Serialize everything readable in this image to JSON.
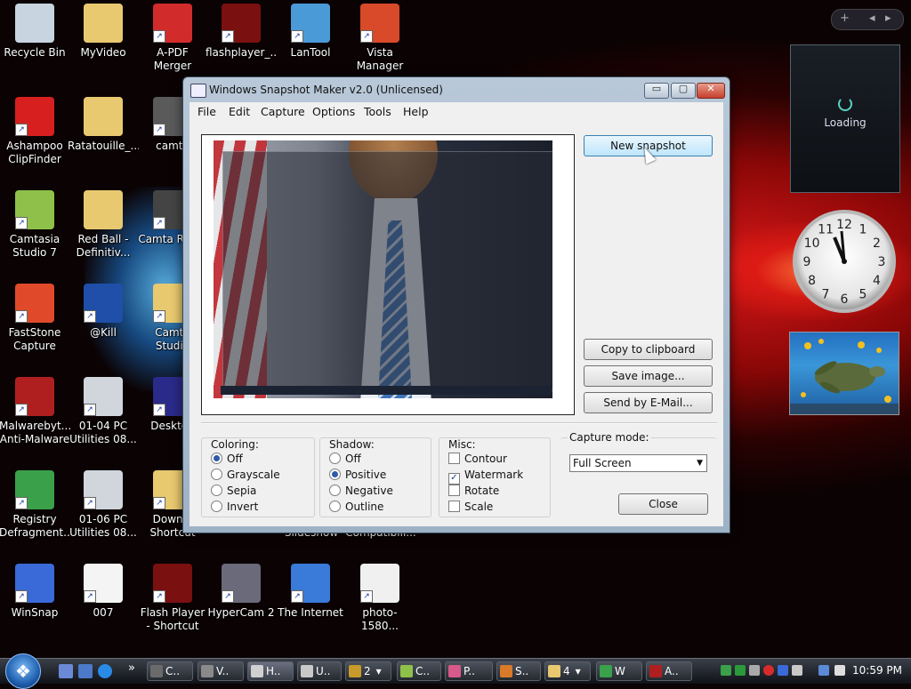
{
  "desktop": {
    "icons": [
      {
        "label": "Recycle Bin",
        "icon": "recycle-bin-icon",
        "color": "#c8d4e0"
      },
      {
        "label": "MyVideo",
        "icon": "folder-icon",
        "color": "#e8c970"
      },
      {
        "label": "A-PDF Merger",
        "icon": "pdf-icon",
        "color": "#d22b2b"
      },
      {
        "label": "flashplayer_...",
        "icon": "flash-icon",
        "color": "#7a1010"
      },
      {
        "label": "LanTool",
        "icon": "lantool-icon",
        "color": "#4a9ad8"
      },
      {
        "label": "Vista Manager",
        "icon": "vista-manager-icon",
        "color": "#d84a2a"
      },
      {
        "label": "Ashampoo ClipFinder",
        "icon": "clipfinder-icon",
        "color": "#d81f1f"
      },
      {
        "label": "Ratatouille_...",
        "icon": "folder-icon",
        "color": "#e8c970"
      },
      {
        "label": "camta",
        "icon": "camtasia-icon",
        "color": "#5a5a5a"
      },
      {
        "label": "Camtasia Studio 7",
        "icon": "camtasia-studio-icon",
        "color": "#8fc14a"
      },
      {
        "label": "Red Ball - Definitiv...",
        "icon": "folder-icon",
        "color": "#e8c970"
      },
      {
        "label": "Camta Recor",
        "icon": "camtasia-recorder-icon",
        "color": "#444444"
      },
      {
        "label": "FastStone Capture",
        "icon": "faststone-icon",
        "color": "#e04a2a"
      },
      {
        "label": "@Kill",
        "icon": "kill-icon",
        "color": "#1f4fa8"
      },
      {
        "label": "Camta Studio",
        "icon": "folder-icon",
        "color": "#e8c970"
      },
      {
        "label": "Malwarebyt... Anti-Malware",
        "icon": "malwarebytes-icon",
        "color": "#b01f1f"
      },
      {
        "label": "01-04 PC Utilities 08...",
        "icon": "disc-icon",
        "color": "#d0d6dc"
      },
      {
        "label": "Desktop",
        "icon": "desktop-icon",
        "color": "#2a2a8a"
      },
      {
        "label": "Registry Defragment...",
        "icon": "registry-icon",
        "color": "#3aa04a"
      },
      {
        "label": "01-06 PC Utilities 08...",
        "icon": "disc-icon",
        "color": "#d0d6dc"
      },
      {
        "label": "Downlo Shortcut",
        "icon": "folder-icon",
        "color": "#e8c970"
      },
      {
        "label": "WinSnap",
        "icon": "winsnap-icon",
        "color": "#3a6ad8"
      },
      {
        "label": "007",
        "icon": "mp3-icon",
        "color": "#f4f4f4"
      },
      {
        "label": "Flash Player - Shortcut",
        "icon": "flash-icon",
        "color": "#7a1010"
      },
      {
        "label": "HyperCam 2",
        "icon": "hypercam-icon",
        "color": "#6a6a7a"
      },
      {
        "label": "The Internet",
        "icon": "internet-icon",
        "color": "#3a7ad8"
      },
      {
        "label": "photo-1580...",
        "icon": "photo-icon",
        "color": "#f0f0f0"
      }
    ],
    "hidden_labels": {
      "slideshow": "Slideshow",
      "compat": "Compatibili..."
    }
  },
  "sidebar": {
    "add_symbol": "+",
    "prev_symbol": "◂",
    "next_symbol": "▸",
    "loading_text": "Loading",
    "clock_numbers": [
      "12",
      "1",
      "2",
      "3",
      "4",
      "5",
      "6",
      "7",
      "8",
      "9",
      "10",
      "11"
    ]
  },
  "window": {
    "title": "Windows Snapshot Maker v2.0 (Unlicensed)",
    "min_symbol": "▭",
    "max_symbol": "▢",
    "close_symbol": "✕",
    "menu": [
      "File",
      "Edit",
      "Capture",
      "Options",
      "Tools",
      "Help"
    ],
    "buttons": {
      "new_snapshot": "New snapshot",
      "copy": "Copy to clipboard",
      "save": "Save image...",
      "email": "Send by E-Mail...",
      "close": "Close"
    },
    "coloring": {
      "title": "Coloring:",
      "options": [
        "Off",
        "Grayscale",
        "Sepia",
        "Invert"
      ],
      "selected": "Off"
    },
    "shadow": {
      "title": "Shadow:",
      "options": [
        "Off",
        "Positive",
        "Negative",
        "Outline"
      ],
      "selected": "Positive"
    },
    "misc": {
      "title": "Misc:",
      "options": [
        "Contour",
        "Watermark",
        "Rotate",
        "Scale"
      ],
      "checked": [
        "Watermark"
      ]
    },
    "capture_mode": {
      "title": "Capture mode:",
      "value": "Full Screen",
      "arrow": "▼"
    }
  },
  "taskbar": {
    "tasks": [
      "C..",
      "V..",
      "H..",
      "U..",
      "2",
      "C..",
      "P..",
      "S..",
      "4",
      "W",
      "A.."
    ],
    "overflow_symbol": "»",
    "dropdown_symbol": "▾",
    "clock": "10:59 PM"
  }
}
